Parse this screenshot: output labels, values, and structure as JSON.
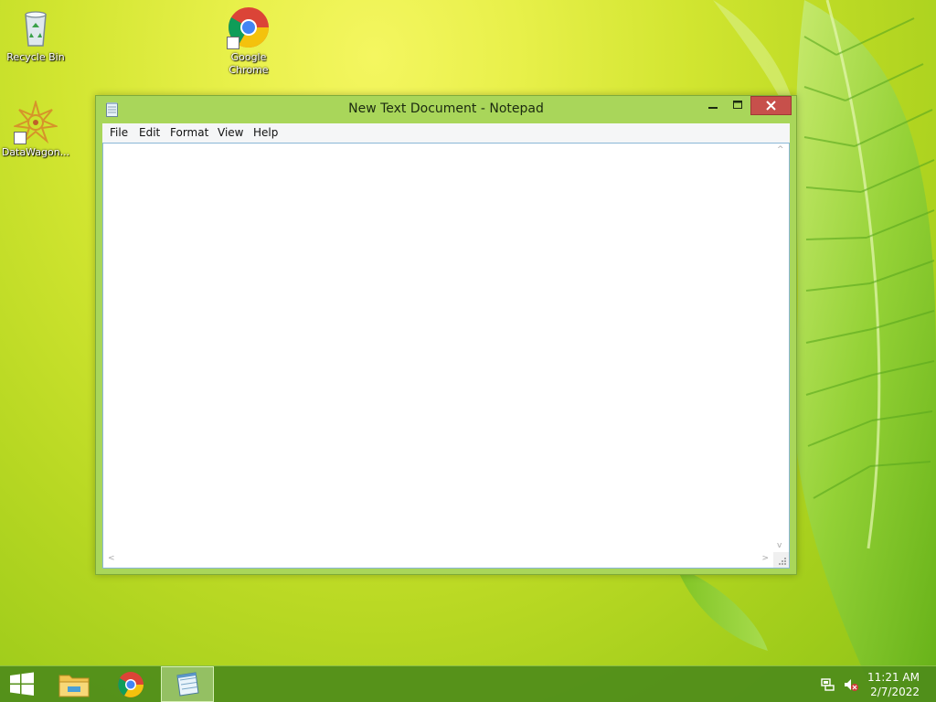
{
  "desktop": {
    "icons": [
      {
        "label": "Recycle Bin",
        "icon": "recycle-bin-icon"
      },
      {
        "label": "Google Chrome",
        "icon": "chrome-icon"
      },
      {
        "label": "DataWagon...",
        "icon": "datawagon-icon"
      }
    ]
  },
  "window": {
    "title": "New Text Document - Notepad",
    "app_icon": "notepad-icon",
    "controls": {
      "minimize": "minimize-icon",
      "maximize": "maximize-icon",
      "close": "close-icon"
    },
    "menu": [
      "File",
      "Edit",
      "Format",
      "View",
      "Help"
    ],
    "content": ""
  },
  "taskbar": {
    "start": "windows-logo-icon",
    "pinned": [
      {
        "name": "File Explorer",
        "icon": "file-explorer-icon"
      },
      {
        "name": "Google Chrome",
        "icon": "chrome-icon"
      },
      {
        "name": "Notepad",
        "icon": "notepad-icon",
        "active": true
      }
    ],
    "tray": {
      "network_icon": "network-icon",
      "volume_icon": "volume-muted-icon",
      "time": "11:21 AM",
      "date": "2/7/2022"
    }
  },
  "colors": {
    "taskbar": "#4e8c1a",
    "window_frame": "#a9d65a",
    "close_button": "#c7504b"
  }
}
